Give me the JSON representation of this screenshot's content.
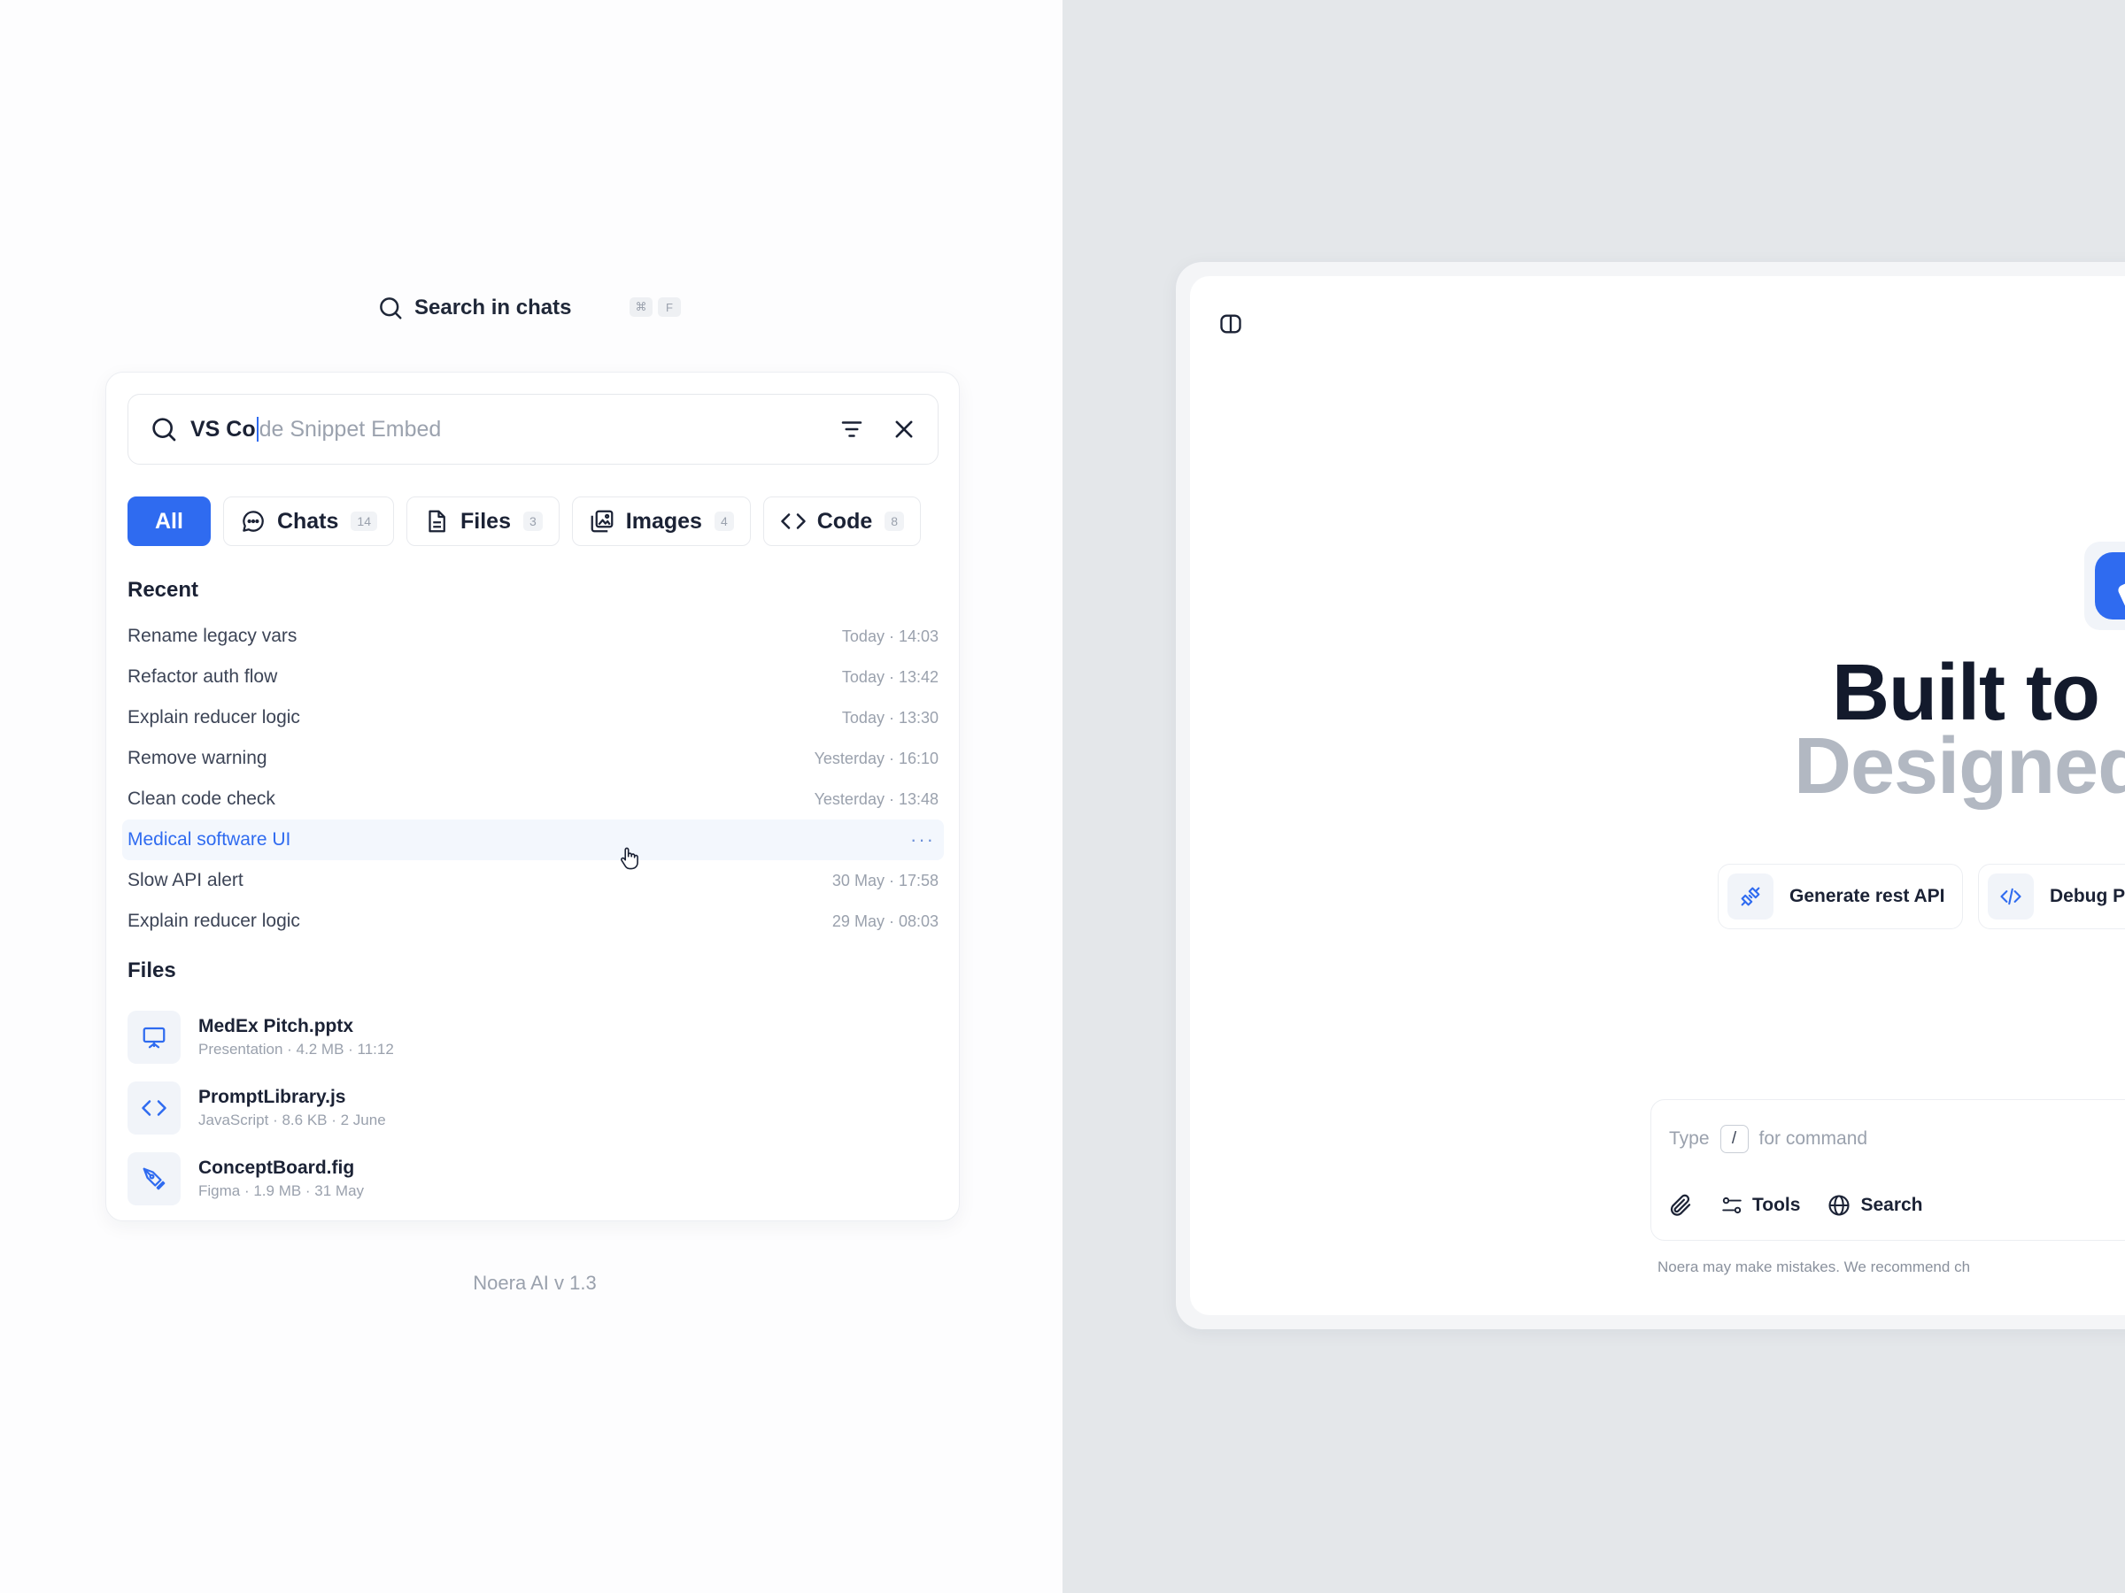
{
  "search_trigger": {
    "label": "Search in chats",
    "shortcut": [
      "⌘",
      "F"
    ]
  },
  "search": {
    "typed": "VS Co",
    "suggestion": "de Snippet Embed"
  },
  "tabs": [
    {
      "label": "All",
      "count": ""
    },
    {
      "label": "Chats",
      "count": "14"
    },
    {
      "label": "Files",
      "count": "3"
    },
    {
      "label": "Images",
      "count": "4"
    },
    {
      "label": "Code",
      "count": "8"
    }
  ],
  "recent": {
    "title": "Recent",
    "items": [
      {
        "title": "Rename legacy vars",
        "time": "Today · 14:03"
      },
      {
        "title": "Refactor auth flow",
        "time": "Today · 13:42"
      },
      {
        "title": "Explain reducer logic",
        "time": "Today · 13:30"
      },
      {
        "title": "Remove warning",
        "time": "Yesterday · 16:10"
      },
      {
        "title": "Clean code check",
        "time": "Yesterday · 13:48"
      },
      {
        "title": "Medical software UI",
        "time": "",
        "more": "···"
      },
      {
        "title": "Slow API alert",
        "time": "30 May · 17:58"
      },
      {
        "title": "Explain reducer logic",
        "time": "29 May · 08:03"
      }
    ]
  },
  "files": {
    "title": "Files",
    "items": [
      {
        "name": "MedEx Pitch.pptx",
        "meta": "Presentation · 4.2 MB · 11:12",
        "icon": "presentation-icon"
      },
      {
        "name": "PromptLibrary.js",
        "meta": "JavaScript · 8.6 KB · 2 June",
        "icon": "code-icon"
      },
      {
        "name": "ConceptBoard.fig",
        "meta": "Figma · 1.9 MB · 31 May",
        "icon": "pen-tool-icon"
      }
    ]
  },
  "version": "Noera AI v 1.3",
  "app": {
    "headline": "Built to",
    "subheadline": "Designed",
    "suggestions": [
      "Generate rest API",
      "Debug P"
    ],
    "composer": {
      "type_label": "Type",
      "slash": "/",
      "command_label": "for command",
      "tools_label": "Tools",
      "search_label": "Search"
    },
    "disclaimer": "Noera may make mistakes. We recommend ch"
  },
  "colors": {
    "accent": "#2f6bf0",
    "right_bg": "#e4e7ea",
    "muted": "#9aa1ad"
  }
}
